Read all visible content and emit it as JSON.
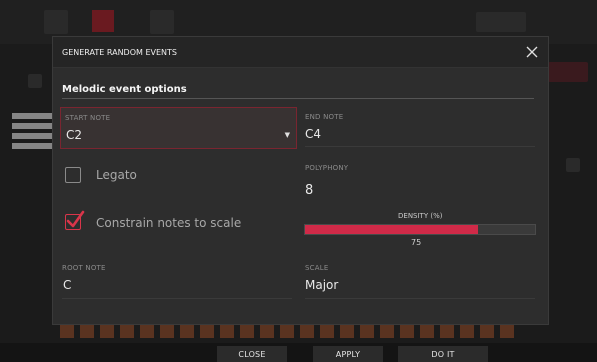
{
  "dialog": {
    "title": "GENERATE RANDOM EVENTS",
    "section_title": "Melodic event options"
  },
  "fields": {
    "start_note": {
      "label": "START NOTE",
      "value": "C2"
    },
    "end_note": {
      "label": "END NOTE",
      "value": "C4"
    },
    "legato": {
      "label": "Legato",
      "checked": false
    },
    "constrain": {
      "label": "Constrain notes to scale",
      "checked": true
    },
    "polyphony": {
      "label": "POLYPHONY",
      "value": "8"
    },
    "density": {
      "label": "DENSITY (%)",
      "value": "75",
      "percent": 75
    },
    "root_note": {
      "label": "ROOT NOTE",
      "value": "C"
    },
    "scale": {
      "label": "SCALE",
      "value": "Major"
    }
  },
  "bottom_buttons": {
    "close": "CLOSE",
    "apply": "APPLY",
    "do_it": "DO IT"
  },
  "colors": {
    "accent": "#d02a48",
    "dialog_bg": "#2d2d2d"
  },
  "icons": {
    "close": "close-icon",
    "dropdown": "chevron-down-icon",
    "check": "checkmark-icon"
  }
}
